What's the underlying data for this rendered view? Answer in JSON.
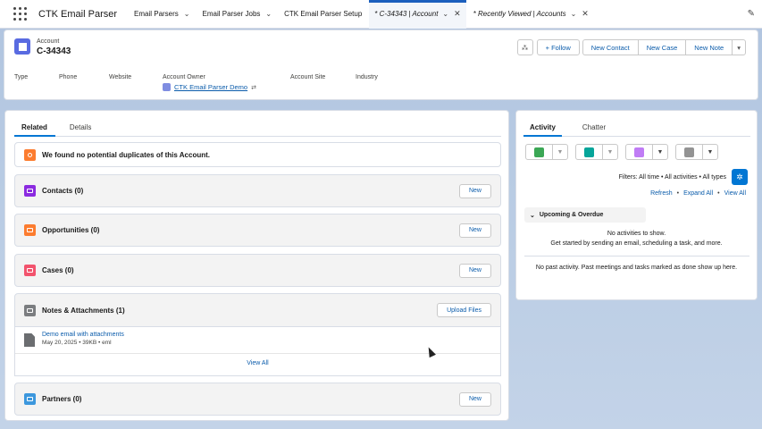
{
  "nav": {
    "app_name": "CTK Email Parser",
    "tabs": [
      {
        "label": "Email Parsers",
        "dropdown": "⌄"
      },
      {
        "label": "Email Parser Jobs",
        "dropdown": "⌄"
      },
      {
        "label": "CTK Email Parser Setup"
      },
      {
        "label": "* C-34343 | Account",
        "dropdown": "⌄",
        "close": "✕"
      },
      {
        "label": "* Recently Viewed | Accounts",
        "dropdown": "⌄",
        "close": "✕"
      }
    ]
  },
  "record": {
    "object_type": "Account",
    "name": "C-34343",
    "actions": {
      "follow": "+ Follow",
      "new_contact": "New Contact",
      "new_case": "New Case",
      "new_note": "New Note",
      "more": "▾"
    },
    "fields": {
      "type_label": "Type",
      "phone_label": "Phone",
      "website_label": "Website",
      "owner_label": "Account Owner",
      "owner_value": "CTK Email Parser Demo",
      "site_label": "Account Site",
      "industry_label": "Industry"
    }
  },
  "left": {
    "tabs": [
      "Related",
      "Details"
    ],
    "duplicates_message": "We found no potential duplicates of this Account.",
    "cards": [
      {
        "title": "Contacts (0)",
        "button": "New",
        "color": "#8b2ae0"
      },
      {
        "title": "Opportunities (0)",
        "button": "New",
        "color": "#fc7c2f"
      },
      {
        "title": "Cases (0)",
        "button": "New",
        "color": "#f2536d"
      },
      {
        "title": "Notes & Attachments (1)",
        "button": "Upload Files",
        "color": "#7b7d80"
      },
      {
        "title": "Partners (0)",
        "button": "New",
        "color": "#3c97dd"
      }
    ],
    "attachment": {
      "name": "Demo email with attachments",
      "meta": "May 20, 2025 • 39KB • eml"
    },
    "view_all": "View All"
  },
  "right": {
    "tabs": [
      "Activity",
      "Chatter"
    ],
    "action_colors": [
      "#3ba755",
      "#06a59a",
      "#c07cf5",
      "#939393"
    ],
    "filters": "Filters: All time • All activities • All types",
    "links": {
      "refresh": "Refresh",
      "expand": "Expand All",
      "view_all": "View All"
    },
    "upcoming": "Upcoming & Overdue",
    "no_activities": "No activities to show.",
    "get_started": "Get started by sending an email, scheduling a task, and more.",
    "no_past": "No past activity. Past meetings and tasks marked as done show up here."
  }
}
